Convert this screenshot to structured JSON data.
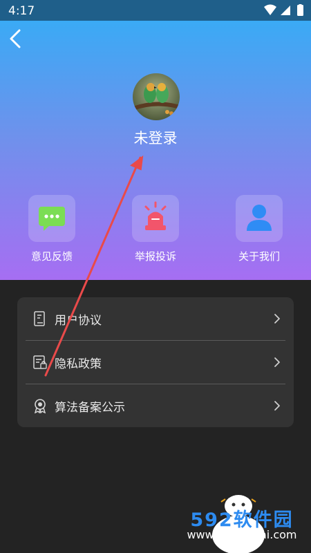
{
  "status": {
    "time": "4:17"
  },
  "profile": {
    "login_label": "未登录"
  },
  "actions": [
    {
      "label": "意见反馈",
      "icon": "chat-bubble-icon",
      "color": "#7bdd54"
    },
    {
      "label": "举报投诉",
      "icon": "siren-icon",
      "color": "#f2556b"
    },
    {
      "label": "关于我们",
      "icon": "person-icon",
      "color": "#2f8cf5"
    }
  ],
  "menu": [
    {
      "label": "用户协议",
      "icon": "agreement-doc-icon"
    },
    {
      "label": "隐私政策",
      "icon": "privacy-doc-icon"
    },
    {
      "label": "算法备案公示",
      "icon": "certificate-badge-icon"
    }
  ],
  "watermark": {
    "brand": "592软件园",
    "url": "www.592xiazai.com"
  },
  "colors": {
    "hero_top": "#3aaaf5",
    "hero_bottom": "#a66ef2",
    "panel": "#333333",
    "background": "#232323",
    "annotation_arrow": "#e94a4a"
  }
}
